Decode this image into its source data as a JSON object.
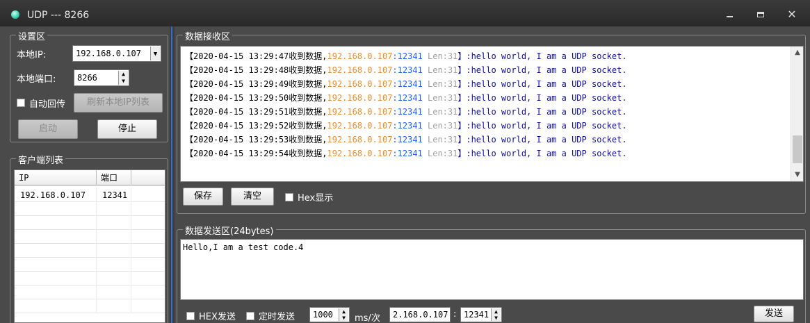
{
  "window": {
    "title": "UDP --- 8266"
  },
  "settings": {
    "group_title": "设置区",
    "local_ip_label": "本地IP:",
    "local_ip_value": "192.168.0.107",
    "local_port_label": "本地端口:",
    "local_port_value": "8266",
    "auto_reply_label": "自动回传",
    "refresh_ip_label": "刷新本地IP列表",
    "start_label": "启动",
    "stop_label": "停止"
  },
  "client_list": {
    "group_title": "客户端列表",
    "columns": [
      "IP",
      "端口"
    ],
    "rows": [
      {
        "ip": "192.168.0.107",
        "port": "12341"
      }
    ]
  },
  "receive": {
    "group_title": "数据接收区",
    "lines": [
      {
        "time": "【2020-04-15 13:29:47收到数据,",
        "ip": "192.168.0.107",
        "port": ":12341",
        "len": " Len:31",
        "msg": "】:hello world, I am a UDP socket."
      },
      {
        "time": "【2020-04-15 13:29:48收到数据,",
        "ip": "192.168.0.107",
        "port": ":12341",
        "len": " Len:31",
        "msg": "】:hello world, I am a UDP socket."
      },
      {
        "time": "【2020-04-15 13:29:49收到数据,",
        "ip": "192.168.0.107",
        "port": ":12341",
        "len": " Len:31",
        "msg": "】:hello world, I am a UDP socket."
      },
      {
        "time": "【2020-04-15 13:29:50收到数据,",
        "ip": "192.168.0.107",
        "port": ":12341",
        "len": " Len:31",
        "msg": "】:hello world, I am a UDP socket."
      },
      {
        "time": "【2020-04-15 13:29:51收到数据,",
        "ip": "192.168.0.107",
        "port": ":12341",
        "len": " Len:31",
        "msg": "】:hello world, I am a UDP socket."
      },
      {
        "time": "【2020-04-15 13:29:52收到数据,",
        "ip": "192.168.0.107",
        "port": ":12341",
        "len": " Len:31",
        "msg": "】:hello world, I am a UDP socket."
      },
      {
        "time": "【2020-04-15 13:29:53收到数据,",
        "ip": "192.168.0.107",
        "port": ":12341",
        "len": " Len:31",
        "msg": "】:hello world, I am a UDP socket."
      },
      {
        "time": "【2020-04-15 13:29:54收到数据,",
        "ip": "192.168.0.107",
        "port": ":12341",
        "len": " Len:31",
        "msg": "】:hello world, I am a UDP socket."
      }
    ],
    "save_label": "保存",
    "clear_label": "清空",
    "hex_display_label": "Hex显示"
  },
  "send": {
    "group_title": "数据发送区(24bytes)",
    "content": "Hello,I am a test code.4",
    "hex_send_label": "HEX发送",
    "timed_send_label": "定时发送",
    "interval_value": "1000",
    "interval_unit": "ms/次",
    "target_ip": "2.168.0.107",
    "ip_port_sep": ":",
    "target_port": "12341",
    "send_label": "发送"
  }
}
